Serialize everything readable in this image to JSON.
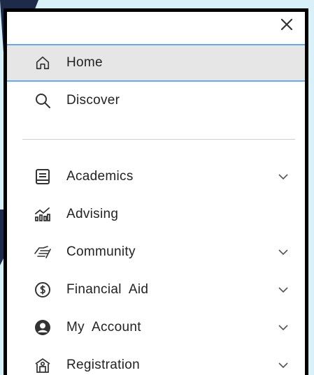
{
  "menu": {
    "close_icon": "close-icon",
    "primary": [
      {
        "label": "Home",
        "icon": "home-icon",
        "active": true
      },
      {
        "label": "Discover",
        "icon": "search-icon",
        "active": false
      }
    ],
    "sections": [
      {
        "label": "Academics",
        "icon": "book-icon",
        "expandable": true
      },
      {
        "label": "Advising",
        "icon": "chart-icon",
        "expandable": false
      },
      {
        "label": "Community",
        "icon": "handshake-icon",
        "expandable": true
      },
      {
        "label": "Financial  Aid",
        "icon": "dollar-circle-icon",
        "expandable": true
      },
      {
        "label": "My  Account",
        "icon": "user-circle-icon",
        "expandable": true
      },
      {
        "label": "Registration",
        "icon": "building-icon",
        "expandable": true
      }
    ]
  },
  "colors": {
    "background": "#d8f0f8",
    "active_border": "#6aa9e8",
    "active_bg": "#e6e6e6",
    "text": "#222222"
  }
}
